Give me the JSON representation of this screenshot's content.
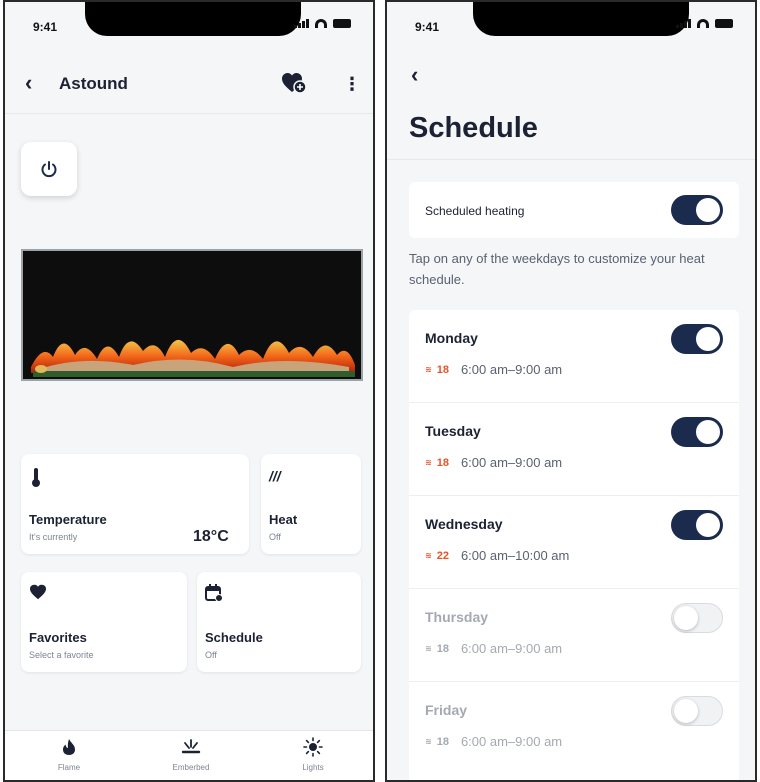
{
  "status_time": "9:41",
  "left": {
    "title": "Astound",
    "cards": {
      "temperature": {
        "title": "Temperature",
        "subtitle": "It's currently",
        "value": "18°C"
      },
      "heat": {
        "title": "Heat",
        "subtitle": "Off"
      },
      "favorites": {
        "title": "Favorites",
        "subtitle": "Select a favorite"
      },
      "schedule": {
        "title": "Schedule",
        "subtitle": "Off"
      }
    },
    "nav": [
      {
        "label": "Flame",
        "icon": "flame-icon"
      },
      {
        "label": "Emberbed",
        "icon": "emberbed-icon"
      },
      {
        "label": "Lights",
        "icon": "sun-icon"
      }
    ]
  },
  "right": {
    "title": "Schedule",
    "scheduled_heating_label": "Scheduled heating",
    "scheduled_heating_on": true,
    "hint": "Tap on any of the weekdays to customize your heat schedule.",
    "heat_icon_glyph": "≋",
    "days": [
      {
        "name": "Monday",
        "temp": "18",
        "time": "6:00 am–9:00 am",
        "on": true
      },
      {
        "name": "Tuesday",
        "temp": "18",
        "time": "6:00 am–9:00 am",
        "on": true
      },
      {
        "name": "Wednesday",
        "temp": "22",
        "time": "6:00 am–10:00 am",
        "on": true
      },
      {
        "name": "Thursday",
        "temp": "18",
        "time": "6:00 am–9:00 am",
        "on": false
      },
      {
        "name": "Friday",
        "temp": "18",
        "time": "6:00 am–9:00 am",
        "on": false
      }
    ]
  },
  "colors": {
    "accent_navy": "#1b2b4d",
    "heat_orange": "#e8542a",
    "background": "#f5f6f8"
  }
}
